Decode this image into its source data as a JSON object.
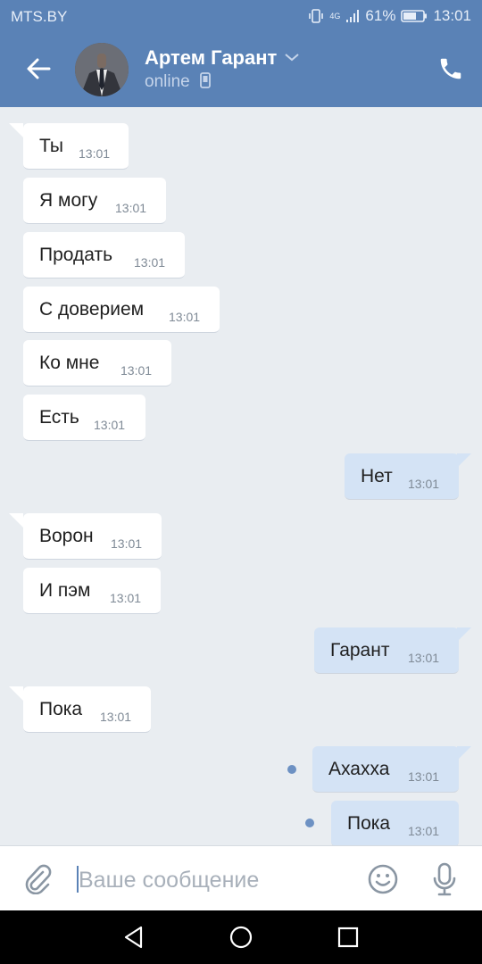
{
  "status_bar": {
    "carrier": "MTS.BY",
    "network": "4G",
    "battery": "61%",
    "time": "13:01"
  },
  "header": {
    "name": "Артем Гарант",
    "status": "online"
  },
  "messages": [
    {
      "dir": "in",
      "text": "Ты",
      "time": "13:01"
    },
    {
      "dir": "in",
      "text": "Я могу",
      "time": "13:01"
    },
    {
      "dir": "in",
      "text": "Продать",
      "time": "13:01"
    },
    {
      "dir": "in",
      "text": "С доверием",
      "time": "13:01"
    },
    {
      "dir": "in",
      "text": "Ко мне",
      "time": "13:01"
    },
    {
      "dir": "in",
      "text": "Есть",
      "time": "13:01"
    },
    {
      "dir": "out",
      "text": "Нет",
      "time": "13:01"
    },
    {
      "dir": "in",
      "text": "Ворон",
      "time": "13:01"
    },
    {
      "dir": "in",
      "text": "И пэм",
      "time": "13:01"
    },
    {
      "dir": "out",
      "text": "Гарант",
      "time": "13:01"
    },
    {
      "dir": "in",
      "text": "Пока",
      "time": "13:01"
    },
    {
      "dir": "out",
      "text": "Ахахха",
      "time": "13:01",
      "unread": true
    },
    {
      "dir": "out",
      "text": "Пока",
      "time": "13:01",
      "unread": true
    }
  ],
  "composer": {
    "placeholder": "Ваше сообщение"
  },
  "colors": {
    "header": "#5a82b6",
    "chat_bg": "#e9edf1",
    "incoming": "#ffffff",
    "outgoing": "#d4e3f5",
    "unread_dot": "#6d91c3"
  }
}
